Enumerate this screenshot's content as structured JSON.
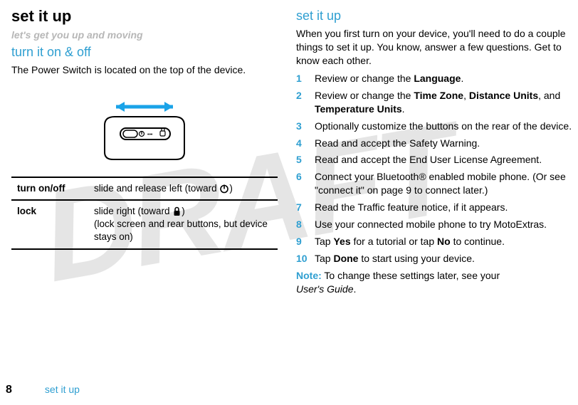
{
  "watermark": "DRAFT",
  "left": {
    "h1": "set it up",
    "subtitle": "let's get you up and moving",
    "h2": "turn it on & off",
    "body1": "The Power Switch is located on the top of the device.",
    "table": {
      "row1_label": "turn on/off",
      "row1_text_a": "slide and release left (toward ",
      "row1_text_b": ")",
      "row2_label": "lock",
      "row2_text_a": "slide right (toward ",
      "row2_text_b": ")",
      "row2_text_c": "(lock screen and rear buttons, but device stays on)"
    }
  },
  "right": {
    "h2": "set it up",
    "intro": "When you first turn on your device, you'll need to do a couple things to set it up. You know, answer a few questions. Get to know each other.",
    "steps": [
      {
        "num": "1",
        "pre": "Review or change the ",
        "b1": "Language",
        "post": "."
      },
      {
        "num": "2",
        "pre": "Review or change the ",
        "b1": "Time Zone",
        "mid1": ", ",
        "b2": "Distance Units",
        "mid2": ", and ",
        "b3": "Temperature Units",
        "post": "."
      },
      {
        "num": "3",
        "txt": "Optionally customize the buttons on the rear of the device."
      },
      {
        "num": "4",
        "txt": "Read and accept the Safety Warning."
      },
      {
        "num": "5",
        "txt": "Read and accept the End User License Agreement."
      },
      {
        "num": "6",
        "txt": "Connect your Bluetooth® enabled mobile phone. (Or see \"connect it\" on page 9 to connect later.)"
      },
      {
        "num": "7",
        "txt": "Read the Traffic feature notice, if it appears."
      },
      {
        "num": "8",
        "txt": "Use your connected mobile phone to try MotoExtras."
      },
      {
        "num": "9",
        "pre": "Tap ",
        "b1": "Yes",
        "mid1": " for a tutorial or tap ",
        "b2": "No",
        "post": " to continue."
      },
      {
        "num": "10",
        "pre": "Tap ",
        "b1": "Done",
        "post": " to start using your device."
      }
    ],
    "note_label": "Note:",
    "note_text": " To change these settings later, see your ",
    "note_guide": "User's Guide",
    "note_end": "."
  },
  "footer": {
    "page_number": "8",
    "section": "set it up"
  }
}
